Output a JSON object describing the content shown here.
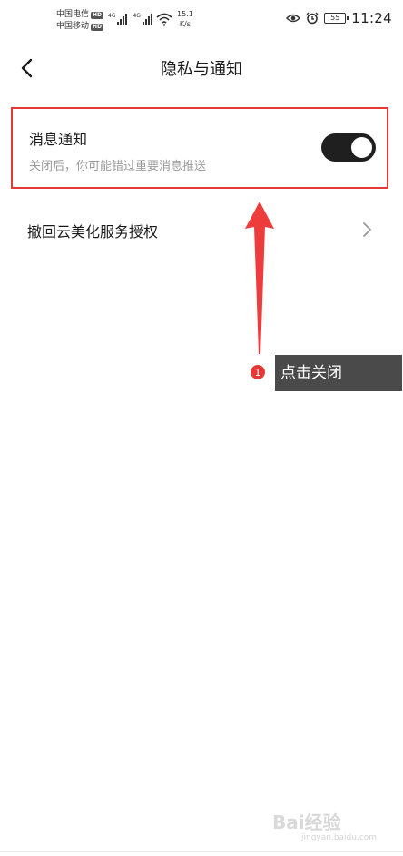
{
  "status_bar": {
    "carrier_1": "中国电信",
    "carrier_2": "中国移动",
    "hd": "HD",
    "net_tag": "4G",
    "speed_value": "15.1",
    "speed_unit": "K/s",
    "battery": "55",
    "time": "11:24"
  },
  "header": {
    "title": "隐私与通知"
  },
  "settings": {
    "notify_title": "消息通知",
    "notify_subtitle": "关闭后，你可能错过重要消息推送",
    "notify_enabled": true,
    "revoke_label": "撤回云美化服务授权"
  },
  "annotation": {
    "step": "1",
    "text": "点击关闭",
    "color": "#e53935"
  },
  "watermark": {
    "text": "Bai经验",
    "sub": "jingyan.baidu.com"
  }
}
